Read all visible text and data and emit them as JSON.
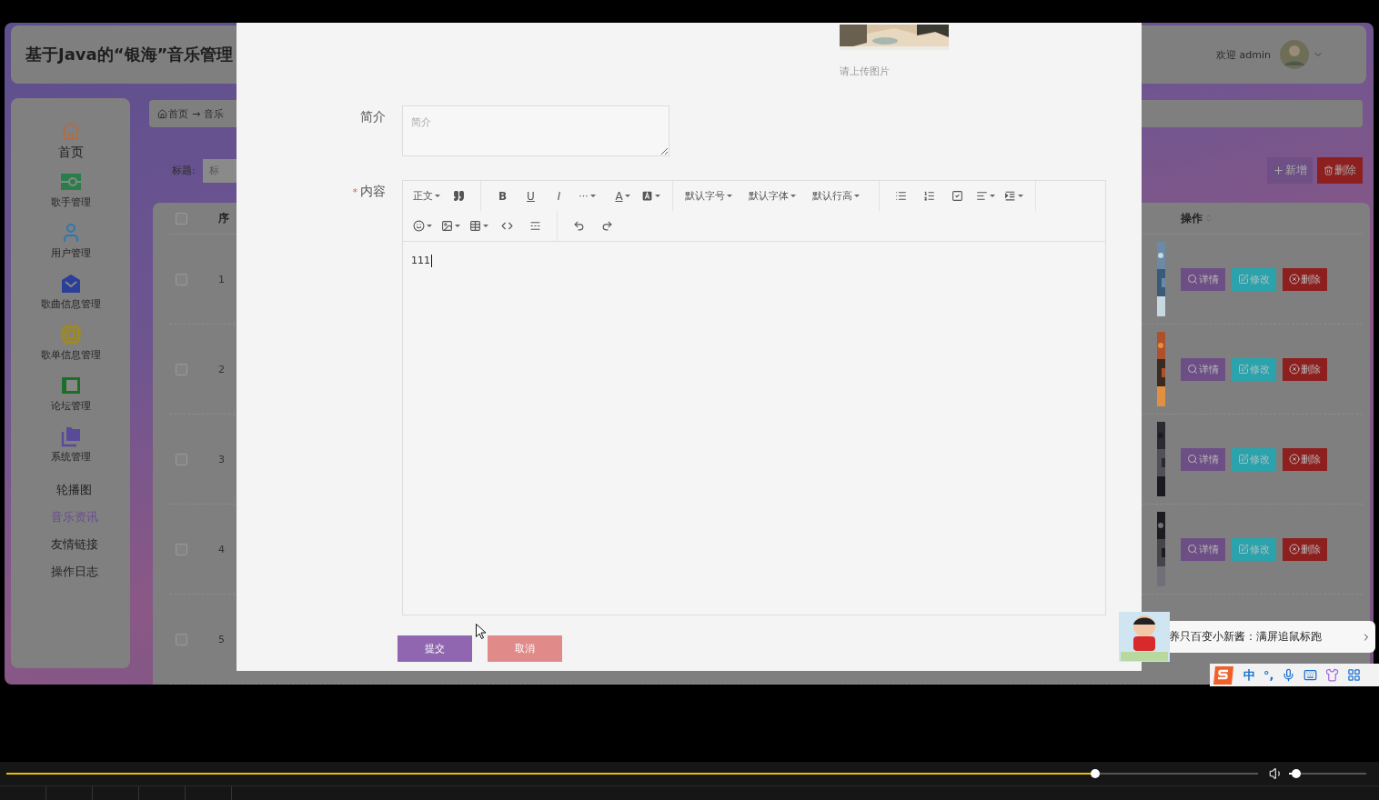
{
  "app": {
    "title": "基于Java的“银海”音乐管理",
    "welcome": "欢迎 admin"
  },
  "sidebar": {
    "items": [
      {
        "kind": "icon",
        "label": "首页",
        "selected": false
      },
      {
        "kind": "icon",
        "label": "歌手管理",
        "selected": false
      },
      {
        "kind": "icon",
        "label": "用户管理",
        "selected": false
      },
      {
        "kind": "icon",
        "label": "歌曲信息管理",
        "selected": false
      },
      {
        "kind": "icon",
        "label": "歌单信息管理",
        "selected": false
      },
      {
        "kind": "icon",
        "label": "论坛管理",
        "selected": false
      },
      {
        "kind": "icon",
        "label": "系统管理",
        "selected": false
      },
      {
        "kind": "text",
        "label": "轮播图",
        "selected": false
      },
      {
        "kind": "text",
        "label": "音乐资讯",
        "selected": true
      },
      {
        "kind": "text",
        "label": "友情链接",
        "selected": false
      },
      {
        "kind": "text",
        "label": "操作日志",
        "selected": false
      }
    ]
  },
  "breadcrumb": {
    "home": "首页",
    "separator": "→",
    "current": "音乐"
  },
  "search": {
    "label": "标题:",
    "placeholder": "标"
  },
  "actions": [
    {
      "kind": "add",
      "label": "新增"
    },
    {
      "kind": "delete",
      "label": "删除"
    }
  ],
  "table": {
    "columns": [
      "序",
      "操作"
    ],
    "header_checked": false,
    "rows": [
      {
        "number": "1",
        "checked": false,
        "actions": [
          {
            "kind": "detail",
            "label": "详情"
          },
          {
            "kind": "edit",
            "label": "修改"
          },
          {
            "kind": "delete",
            "label": "删除"
          }
        ]
      },
      {
        "number": "2",
        "checked": false,
        "actions": [
          {
            "kind": "detail",
            "label": "详情"
          },
          {
            "kind": "edit",
            "label": "修改"
          },
          {
            "kind": "delete",
            "label": "删除"
          }
        ]
      },
      {
        "number": "3",
        "checked": false,
        "actions": [
          {
            "kind": "detail",
            "label": "详情"
          },
          {
            "kind": "edit",
            "label": "修改"
          },
          {
            "kind": "delete",
            "label": "删除"
          }
        ]
      },
      {
        "number": "4",
        "checked": false,
        "actions": [
          {
            "kind": "detail",
            "label": "详情"
          },
          {
            "kind": "edit",
            "label": "修改"
          },
          {
            "kind": "delete",
            "label": "删除"
          }
        ]
      },
      {
        "number": "5",
        "checked": false
      }
    ]
  },
  "modal": {
    "upload_hint": "请上传图片",
    "fields": [
      {
        "kind": "textarea",
        "label": "简介",
        "placeholder": "简介"
      },
      {
        "kind": "editor",
        "label": "内容",
        "required_mark": "*",
        "value": "111"
      }
    ],
    "editor_toolbar": [
      [
        {
          "kind": "menu",
          "label": "正文",
          "dropdown": true
        },
        {
          "kind": "icon",
          "dropdown": false
        },
        {
          "kind": "divider"
        },
        {
          "kind": "menu",
          "label": "B",
          "dropdown": false
        },
        {
          "kind": "menu",
          "label": "U",
          "dropdown": false
        },
        {
          "kind": "menu",
          "label": "I",
          "dropdown": false
        },
        {
          "kind": "menu",
          "label": "···",
          "dropdown": true
        },
        {
          "kind": "menu",
          "label": "A",
          "dropdown": true
        },
        {
          "kind": "icon",
          "dropdown": true
        },
        {
          "kind": "divider"
        },
        {
          "kind": "menu",
          "label": "默认字号",
          "dropdown": true
        },
        {
          "kind": "menu",
          "label": "默认字体",
          "dropdown": true
        },
        {
          "kind": "menu",
          "label": "默认行高",
          "dropdown": true
        },
        {
          "kind": "divider"
        },
        {
          "kind": "icon",
          "dropdown": false
        },
        {
          "kind": "icon",
          "dropdown": false
        },
        {
          "kind": "icon",
          "dropdown": false
        },
        {
          "kind": "icon",
          "dropdown": true
        },
        {
          "kind": "icon",
          "dropdown": true
        },
        {
          "kind": "divider"
        }
      ],
      [
        {
          "kind": "icon",
          "dropdown": true
        },
        {
          "kind": "icon",
          "dropdown": true
        },
        {
          "kind": "icon",
          "dropdown": true
        },
        {
          "kind": "icon",
          "dropdown": false
        },
        {
          "kind": "icon",
          "dropdown": false
        },
        {
          "kind": "divider"
        },
        {
          "kind": "icon",
          "dropdown": false
        },
        {
          "kind": "icon",
          "dropdown": false
        }
      ]
    ],
    "buttons": [
      {
        "kind": "primary",
        "label": "提交"
      },
      {
        "kind": "secondary",
        "label": "取消"
      }
    ]
  },
  "popup": {
    "text": "养只百变小新酱：满屏追鼠标跑"
  },
  "ime_bar": {
    "mode": "中",
    "punctuation": "°,"
  },
  "player": {
    "progress": {
      "level": 0.87
    },
    "volume": {
      "level": 0.09
    }
  }
}
